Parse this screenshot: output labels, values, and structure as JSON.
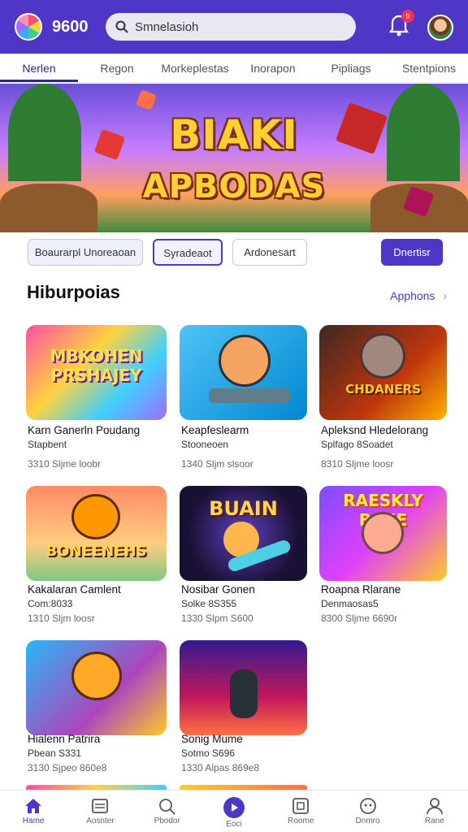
{
  "header": {
    "brand": "9600",
    "search_placeholder": "Smnelasioh",
    "notification_count": "9"
  },
  "tabs": [
    "Nerlen",
    "Regon",
    "Morkeplestas",
    "Inorapon",
    "Pipliags",
    "Stentpions"
  ],
  "banner": {
    "line1": "BIAKI",
    "line2": "APBODAS"
  },
  "filters": [
    "Boaurarpl Unoreaoan",
    "Syradeaot",
    "Ardonesart",
    "Dnertisr"
  ],
  "section": {
    "title": "Hiburpoias",
    "link": "Apphons"
  },
  "games": [
    {
      "title": "Karn Ganerln Poudang",
      "subtitle": "Stapbent",
      "meta": "3310 Sljme loobr",
      "art_text": "MBKOHEN PRSHAJEY"
    },
    {
      "title": "Keapfeslearm",
      "subtitle": "Stooneoen",
      "meta": "1340 Sljm slsoor",
      "art_text": ""
    },
    {
      "title": "Apleksnd Hledelorang",
      "subtitle": "Splfago 8Soadet",
      "meta": "8310 Sljme loosr",
      "art_text": "CHDANERS"
    },
    {
      "title": "Kakalaran Camlent",
      "subtitle": "Com:8033",
      "meta": "1310 Sljm loosr",
      "art_text": "BONEENEHS"
    },
    {
      "title": "Nosibar Gonen",
      "subtitle": "Solke 8S355",
      "meta": "1330 Slpm S600",
      "art_text": "BUAIN"
    },
    {
      "title": "Roapna Rlarane",
      "subtitle": "Denmaosas5",
      "meta": "8300 Sljme 6690r",
      "art_text": "RAESKLY BAIJE"
    },
    {
      "title": "Hialenn Patrira",
      "subtitle": "Pbean S331",
      "meta": "3130 Sjpeo 860e8",
      "art_text": ""
    },
    {
      "title": "Sonig Mume",
      "subtitle": "Sotmo S696",
      "meta": "1330 Alpas 869e8",
      "art_text": ""
    }
  ],
  "nav": [
    "Hame",
    "Aosnter",
    "Pbodor",
    "Eoci",
    "Roome",
    "Dnmro",
    "Rane"
  ],
  "colors": {
    "primary": "#4f36c7",
    "search_bg": "#e9e8f1",
    "badge": "#ff2d55"
  }
}
